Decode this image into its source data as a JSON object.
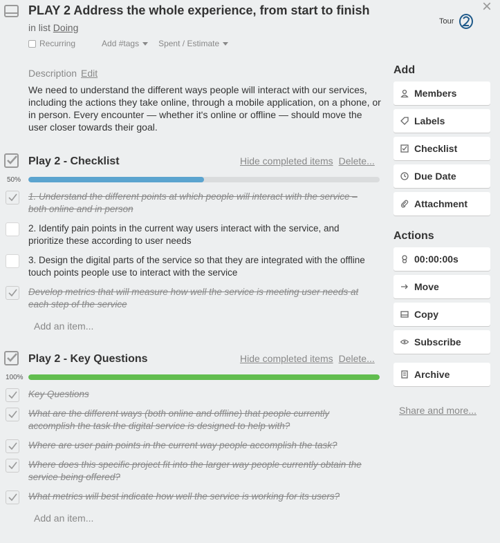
{
  "card": {
    "title": "PLAY 2 Address the whole experience, from start to finish",
    "in_list_prefix": "in list",
    "list_name": "Doing",
    "close_glyph": "×",
    "icon": "card-icon"
  },
  "header": {
    "tour_label": "Tour",
    "tour_icon": "tour-logo-icon"
  },
  "meta": {
    "recurring_label": "Recurring",
    "tags_label": "Add #tags",
    "spent_label": "Spent / Estimate"
  },
  "description": {
    "heading": "Description",
    "edit_label": "Edit",
    "text": "We need to understand the different ways people will interact with our services, including the actions they take online, through a mobile application, on a phone, or in person. Every encounter — whether it's online or offline — should move the user closer towards their goal."
  },
  "checklists": [
    {
      "title": "Play 2 - Checklist",
      "hide_label": "Hide completed items",
      "delete_label": "Delete...",
      "percent_label": "50%",
      "progress": 0.5,
      "bar_color": "#5ba4cf",
      "items": [
        {
          "text": "1. Understand the different points at which people will interact with the service – both online and in person",
          "done": true
        },
        {
          "text": "2. Identify pain points in the current way users interact with the service, and prioritize these according to user needs",
          "done": false
        },
        {
          "text": "3. Design the digital parts of the service so that they are integrated with the offline touch points people use to interact with the service",
          "done": false
        },
        {
          "text": "Develop metrics that will measure how well the service is meeting user needs at each step of the service",
          "done": true
        }
      ],
      "add_label": "Add an item..."
    },
    {
      "title": "Play 2 - Key Questions",
      "hide_label": "Hide completed items",
      "delete_label": "Delete...",
      "percent_label": "100%",
      "progress": 1.0,
      "bar_color": "#61bd4f",
      "items": [
        {
          "text": "Key Questions",
          "done": true
        },
        {
          "text": "What are the different ways (both online and offline) that people currently accomplish the task the digital service is designed to help with?",
          "done": true
        },
        {
          "text": "Where are user pain points in the current way people accomplish the task?",
          "done": true
        },
        {
          "text": "Where does this specific project fit into the larger way people currently obtain the service being offered?",
          "done": true
        },
        {
          "text": "What metrics will best indicate how well the service is working for its users?",
          "done": true
        }
      ],
      "add_label": "Add an item..."
    }
  ],
  "sidebar": {
    "add_heading": "Add",
    "add_buttons": [
      {
        "label": "Members",
        "icon": "person-icon"
      },
      {
        "label": "Labels",
        "icon": "tag-icon"
      },
      {
        "label": "Checklist",
        "icon": "checkbox-icon"
      },
      {
        "label": "Due Date",
        "icon": "clock-icon"
      },
      {
        "label": "Attachment",
        "icon": "paperclip-icon"
      }
    ],
    "actions_heading": "Actions",
    "action_buttons": [
      {
        "label": "00:00:00s",
        "icon": "timer-icon"
      },
      {
        "label": "Move",
        "icon": "arrow-right-icon"
      },
      {
        "label": "Copy",
        "icon": "card-copy-icon"
      },
      {
        "label": "Subscribe",
        "icon": "eye-icon"
      },
      {
        "label": "Archive",
        "icon": "archive-icon"
      }
    ],
    "share_label": "Share and more..."
  }
}
